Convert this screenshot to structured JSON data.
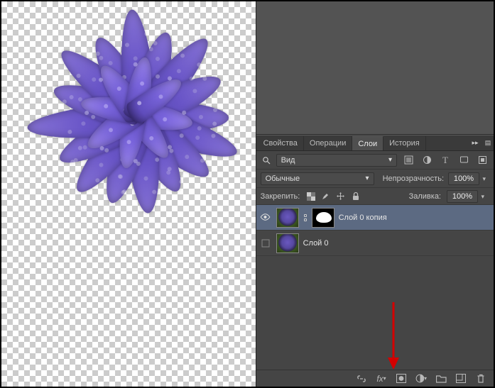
{
  "tabs": {
    "properties": "Свойства",
    "operations": "Операции",
    "layers": "Слои",
    "history": "История",
    "active": "layers"
  },
  "filter": {
    "kind_label": "Вид"
  },
  "blend": {
    "mode": "Обычные",
    "opacity_label": "Непрозрачность:",
    "opacity_value": "100%"
  },
  "lock": {
    "label": "Закрепить:",
    "fill_label": "Заливка:",
    "fill_value": "100%"
  },
  "layers": [
    {
      "name": "Слой 0 копия",
      "visible": true,
      "selected": true,
      "has_mask": true
    },
    {
      "name": "Слой 0",
      "visible": false,
      "selected": false,
      "has_mask": false
    }
  ],
  "colors": {
    "accent": "#5c6a82",
    "panel": "#454545",
    "arrow": "#d40000"
  }
}
